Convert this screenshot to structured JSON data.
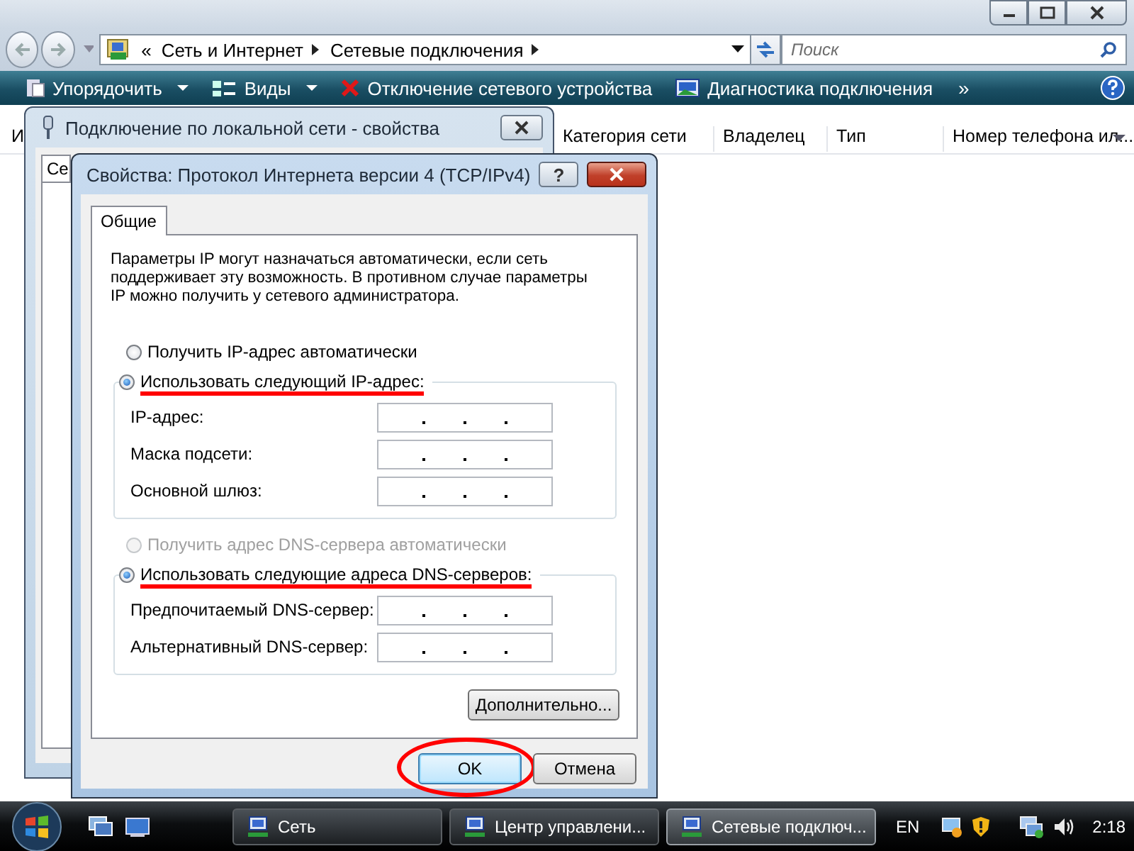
{
  "explorer": {
    "breadcrumb": [
      "«",
      "Сеть и Интернет",
      "Сетевые подключения"
    ],
    "search": {
      "placeholder": "Поиск"
    },
    "toolbar": [
      {
        "label": "Упорядочить",
        "kind": "menu"
      },
      {
        "label": "Виды",
        "kind": "menu"
      },
      {
        "label": "Отключение сетевого устройства",
        "kind": "action"
      },
      {
        "label": "Диагностика подключения",
        "kind": "action"
      }
    ],
    "toolbar_more": "»",
    "columns": [
      "И",
      "Категория сети",
      "Владелец",
      "Тип",
      "Номер телефона ил..."
    ]
  },
  "back_dialog": {
    "title": "Подключение по локальной сети - свойства",
    "tabs": [
      {
        "label": "Се",
        "selected": true
      }
    ]
  },
  "dialog": {
    "title": "Свойства: Протокол Интернета версии 4 (TCP/IPv4)",
    "help": "?",
    "tabs": [
      {
        "label": "Общие",
        "selected": true
      }
    ],
    "description": "Параметры IP могут назначаться автоматически, если сеть поддерживает эту возможность. В противном случае параметры IP можно получить у сетевого администратора.",
    "ip_mode": [
      {
        "label": "Получить IP-адрес автоматически",
        "selected": false,
        "disabled": false,
        "highlighted": false
      },
      {
        "label": "Использовать следующий IP-адрес:",
        "selected": true,
        "disabled": false,
        "highlighted": true
      }
    ],
    "ip_fields": [
      {
        "label": "IP-адрес:"
      },
      {
        "label": "Маска подсети:"
      },
      {
        "label": "Основной шлюз:"
      }
    ],
    "dns_mode": [
      {
        "label": "Получить адрес DNS-сервера автоматически",
        "selected": false,
        "disabled": true,
        "highlighted": false
      },
      {
        "label": "Использовать следующие адреса DNS-серверов:",
        "selected": true,
        "disabled": false,
        "highlighted": true
      }
    ],
    "dns_fields": [
      {
        "label": "Предпочитаемый DNS-сервер:"
      },
      {
        "label": "Альтернативный DNS-сервер:"
      }
    ],
    "advanced_button": "Дополнительно...",
    "buttons": [
      {
        "label": "OK",
        "default": true,
        "circled": true
      },
      {
        "label": "Отмена",
        "default": false,
        "circled": false
      }
    ]
  },
  "taskbar": {
    "tasks": [
      {
        "label": "Сеть",
        "selected": false
      },
      {
        "label": "Центр управлени...",
        "selected": false
      },
      {
        "label": "Сетевые подключ...",
        "selected": true
      }
    ],
    "language": "EN",
    "clock": "2:18"
  }
}
